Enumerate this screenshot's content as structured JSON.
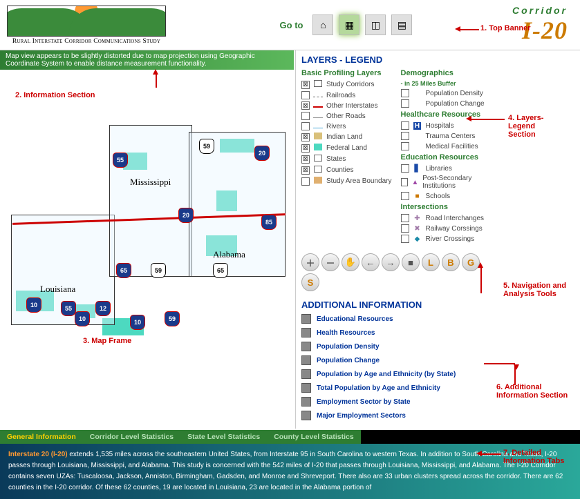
{
  "banner": {
    "logo_title": "Rural Interstate Corridor Communications Study",
    "goto_label": "Go to",
    "corridor_label": "Corridor",
    "corridor_id": "I-20"
  },
  "info_strip": "Map view appears to be slightly distorted due to map projection using Geographic Coordinate System to enable distance measurement functionality.",
  "map": {
    "states": {
      "la": "Louisiana",
      "ms": "Mississippi",
      "al": "Alabama"
    },
    "shields": [
      "55",
      "20",
      "59",
      "20",
      "85",
      "65",
      "59",
      "65",
      "10",
      "12",
      "10",
      "55",
      "10",
      "59"
    ]
  },
  "legend": {
    "title": "LAYERS - LEGEND",
    "basic_title": "Basic Profiling Layers",
    "basic_items": [
      {
        "label": "Study Corridors",
        "checked": true,
        "sym": "bx"
      },
      {
        "label": "Railroads",
        "checked": false,
        "sym": "rail"
      },
      {
        "label": "Other Interstates",
        "checked": true,
        "sym": "red"
      },
      {
        "label": "Other Roads",
        "checked": false,
        "sym": "road"
      },
      {
        "label": "Rivers",
        "checked": false,
        "sym": "river"
      },
      {
        "label": "Indian Land",
        "checked": true,
        "sym": "il"
      },
      {
        "label": "Federal Land",
        "checked": true,
        "sym": "fl"
      },
      {
        "label": "States",
        "checked": true,
        "sym": "st"
      },
      {
        "label": "Counties",
        "checked": true,
        "sym": "co"
      },
      {
        "label": "Study Area Boundary",
        "checked": false,
        "sym": "sab"
      }
    ],
    "demo_title": "Demographics",
    "demo_note": "- in 25 Miles Buffer",
    "demo_items": [
      {
        "label": "Population Density",
        "checked": false
      },
      {
        "label": "Population Change",
        "checked": false
      }
    ],
    "health_title": "Healthcare Resources",
    "health_items": [
      {
        "label": "Hospitals",
        "checked": false,
        "sym": "H"
      },
      {
        "label": "Trauma Centers",
        "checked": false
      },
      {
        "label": "Medical Facilities",
        "checked": false
      }
    ],
    "edu_title": "Education Resources",
    "edu_items": [
      {
        "label": "Libraries",
        "checked": false,
        "sym": "L"
      },
      {
        "label": "Post-Secondary Institutions",
        "checked": false,
        "sym": "P"
      },
      {
        "label": "Schools",
        "checked": false,
        "sym": "S"
      }
    ],
    "int_title": "Intersections",
    "int_items": [
      {
        "label": "Road Interchanges",
        "checked": false,
        "sym": "✚"
      },
      {
        "label": "Railway Corssings",
        "checked": false,
        "sym": "✖"
      },
      {
        "label": "River Crossings",
        "checked": false,
        "sym": "◆"
      }
    ]
  },
  "tools": {
    "buttons": [
      "＋",
      "－",
      "✋",
      "←",
      "→",
      "■",
      "L",
      "B",
      "G",
      "S"
    ]
  },
  "addinfo": {
    "title": "ADDITIONAL INFORMATION",
    "items": [
      "Educational Resources",
      "Health Resources",
      "Population Density",
      "Population Change",
      "Population by Age and Ethnicity (by State)",
      "Total Population by Age and Ethnicity",
      "Employment Sector by State",
      "Major Employment Sectors"
    ]
  },
  "tabs": {
    "items": [
      "General Information",
      "Corridor Level Statistics",
      "State Level Statistics",
      "County Level Statistics"
    ],
    "content_heading": "Interstate 20 (I-20)",
    "content_body": " extends 1,535 miles across the southeastern United States, from Interstate 95 in South Carolina to western Texas. In addition to South Carolina and Texas, I-20 passes through Louisiana, Mississippi, and Alabama. This study is concerned with the 542 miles of I-20 that passes through Louisiana, Mississippi, and Alabama. The I-20 Corridor contains seven UZAs: Tuscaloosa, Jackson, Anniston, Birmingham, Gadsden, and Monroe and Shreveport. There also are 33 urban clusters spread across the corridor. There are 62 counties in the I-20 corridor. Of these 62 counties, 19 are located in Louisiana, 23 are located in the Alabama portion of"
  },
  "annotations": {
    "a1": "1. Top Banner",
    "a2": "2. Information Section",
    "a3": "3. Map Frame",
    "a4": "4. Layers-Legend Section",
    "a5": "5. Navigation and Analysis Tools",
    "a6": "6. Additional Information Section",
    "a7": "7. Detailed Information Tabs"
  }
}
